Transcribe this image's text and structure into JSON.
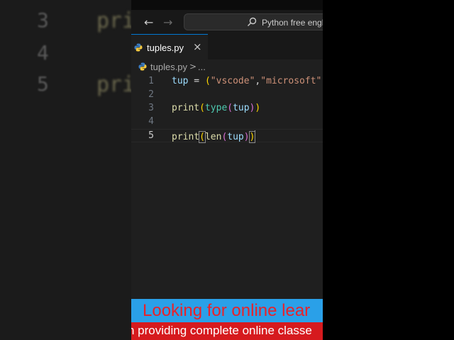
{
  "background": {
    "lines": [
      {
        "num": "3",
        "code": "pri"
      },
      {
        "num": "4",
        "code": ""
      },
      {
        "num": "5",
        "code": "pri"
      }
    ]
  },
  "titlebar": {
    "search_text": "Python free engl"
  },
  "tab": {
    "label": "tuples.py",
    "close_symbol": "×"
  },
  "breadcrumb": {
    "file": "tuples.py",
    "separator": ">",
    "ellipsis": "..."
  },
  "editor": {
    "line_numbers": [
      "1",
      "2",
      "3",
      "4",
      "5"
    ],
    "active_line": "5",
    "lines": [
      [
        {
          "text": "tup",
          "c": "var"
        },
        {
          "text": " = ",
          "c": "op"
        },
        {
          "text": "(",
          "c": "b1"
        },
        {
          "text": "\"vscode\"",
          "c": "str"
        },
        {
          "text": ",",
          "c": "op"
        },
        {
          "text": "\"microsoft\"",
          "c": "str"
        },
        {
          "text": ",",
          "c": "op"
        }
      ],
      [],
      [
        {
          "text": "print",
          "c": "fn"
        },
        {
          "text": "(",
          "c": "b1"
        },
        {
          "text": "type",
          "c": "type"
        },
        {
          "text": "(",
          "c": "b2"
        },
        {
          "text": "tup",
          "c": "var"
        },
        {
          "text": ")",
          "c": "b2"
        },
        {
          "text": ")",
          "c": "b1"
        }
      ],
      [],
      [
        {
          "text": "print",
          "c": "fn"
        },
        {
          "text": "(",
          "c": "b1 bm"
        },
        {
          "text": "len",
          "c": "fn"
        },
        {
          "text": "(",
          "c": "b2"
        },
        {
          "text": "tup",
          "c": "var"
        },
        {
          "text": ")",
          "c": "b2"
        },
        {
          "text": ")",
          "c": "b1 bm"
        }
      ]
    ]
  },
  "banners": {
    "top_text": "Looking for online lear",
    "bottom_text": "n providing complete online classe"
  },
  "colors": {
    "accent": "#0078d4",
    "banner_blue": "#2aa0e8",
    "banner_red": "#d61a1e"
  }
}
